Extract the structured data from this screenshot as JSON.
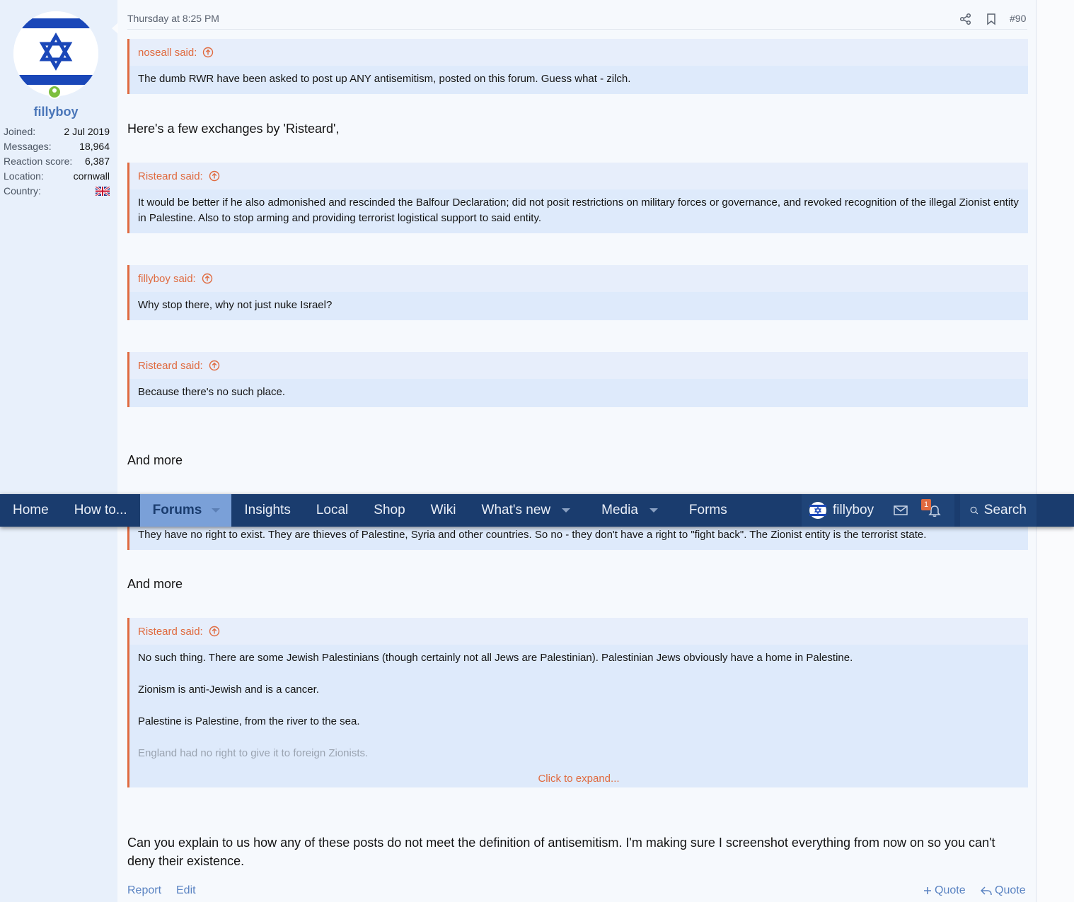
{
  "user": {
    "name": "fillyboy",
    "stats": [
      {
        "label": "Joined:",
        "value": "2 Jul 2019"
      },
      {
        "label": "Messages:",
        "value": "18,964"
      },
      {
        "label": "Reaction score:",
        "value": "6,387"
      },
      {
        "label": "Location:",
        "value": "cornwall"
      },
      {
        "label": "Country:",
        "value": ""
      }
    ]
  },
  "post": {
    "time": "Thursday at 8:25 PM",
    "number": "#90",
    "text1": "Here's a few exchanges by 'Risteard',",
    "text2": "And more",
    "text3": "And more",
    "final": "Can you explain to us how any of these posts do not meet the definition of antisemitism. I'm making sure I screenshot everything from now on so you can't deny their existence."
  },
  "quotes": [
    {
      "author": "noseall said:",
      "lines": [
        "The dumb RWR have been asked to post up ANY antisemitism, posted on this forum. Guess what - zilch."
      ]
    },
    {
      "author": "Risteard said:",
      "lines": [
        "It would be better if he also admonished and rescinded the Balfour Declaration; did not posit restrictions on military forces or governance, and revoked recognition of the illegal Zionist entity in Palestine. Also to stop arming and providing terrorist logistical support to said entity."
      ]
    },
    {
      "author": "fillyboy said:",
      "lines": [
        "Why stop there, why not just nuke Israel?"
      ]
    },
    {
      "author": "Risteard said:",
      "lines": [
        "Because there's no such place."
      ]
    },
    {
      "author": "",
      "lines": [
        "They have no right to exist. They are thieves of Palestine, Syria and other countries. So no - they don't have a right to \"fight back\". The Zionist entity is the terrorist state."
      ]
    },
    {
      "author": "Risteard said:",
      "lines": [
        "No such thing. There are some Jewish Palestinians (though certainly not all Jews are Palestinian). Palestinian Jews obviously have a home in Palestine.",
        "Zionism is anti-Jewish and is a cancer.",
        "Palestine is Palestine, from the river to the sea.",
        "England had no right to give it to foreign Zionists."
      ],
      "expand": "Click to expand..."
    }
  ],
  "nav": {
    "items": [
      "Home",
      "How to...",
      "Forums",
      "Insights",
      "Local",
      "Shop",
      "Wiki",
      "What's new",
      "Media",
      "Forms"
    ],
    "user": "fillyboy",
    "alerts_count": "1",
    "search": "Search"
  },
  "footer": {
    "report": "Report",
    "edit": "Edit",
    "multiquote": "Quote",
    "quote": "Quote"
  },
  "colors": {
    "accent": "#e06a3f",
    "nav": "#1a3c6e",
    "link": "#5a83c2",
    "sidebar": "#e8f0fb"
  }
}
